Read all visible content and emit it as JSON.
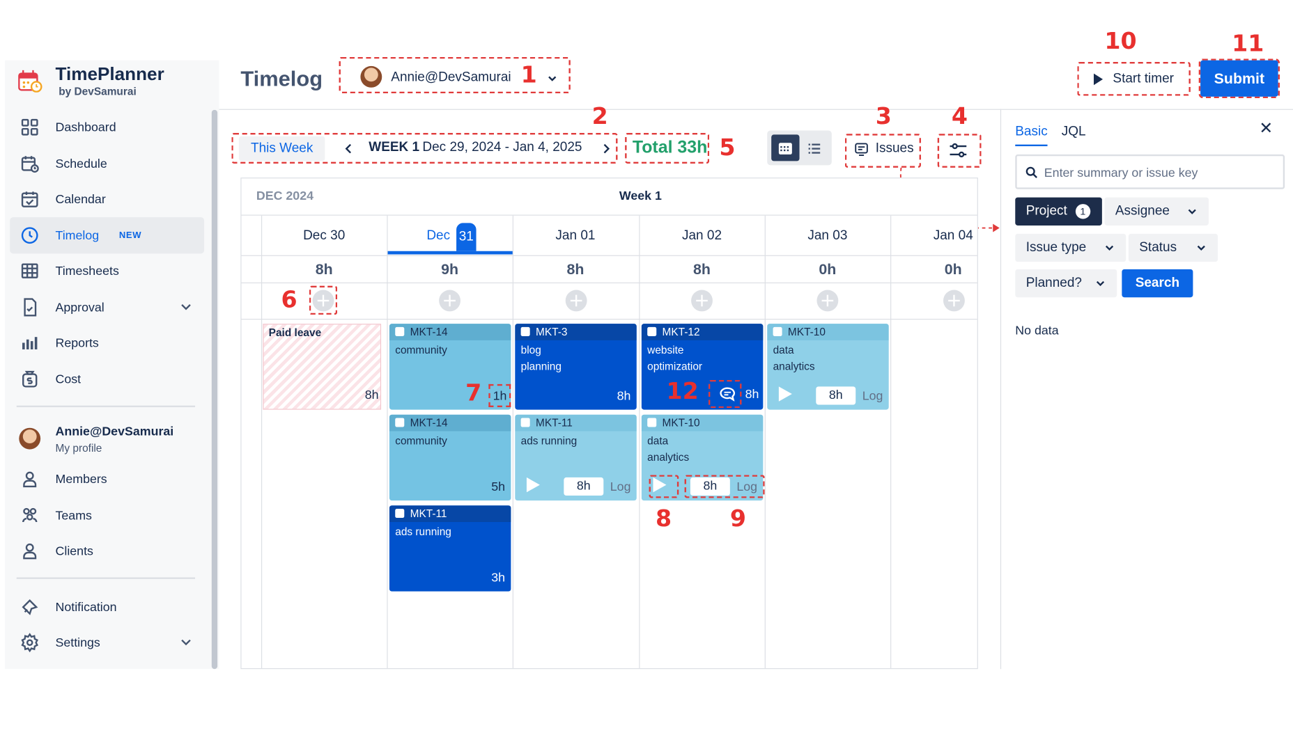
{
  "app": {
    "name": "TimePlanner",
    "by": "by DevSamurai"
  },
  "sidebar": {
    "items": [
      {
        "label": "Dashboard",
        "icon": "dashboard-icon"
      },
      {
        "label": "Schedule",
        "icon": "schedule-icon"
      },
      {
        "label": "Calendar",
        "icon": "calendar-icon"
      },
      {
        "label": "Timelog",
        "icon": "clock-icon",
        "badge": "NEW",
        "active": true
      },
      {
        "label": "Timesheets",
        "icon": "table-icon"
      },
      {
        "label": "Approval",
        "icon": "document-icon",
        "expandable": true
      },
      {
        "label": "Reports",
        "icon": "bar-chart-icon"
      },
      {
        "label": "Cost",
        "icon": "money-icon"
      }
    ],
    "profile": {
      "name": "Annie@DevSamurai",
      "sub": "My profile"
    },
    "people": [
      {
        "label": "Members",
        "icon": "person-icon"
      },
      {
        "label": "Teams",
        "icon": "team-icon"
      },
      {
        "label": "Clients",
        "icon": "client-icon"
      }
    ],
    "bottom": [
      {
        "label": "Notification",
        "icon": "bell-icon"
      },
      {
        "label": "Settings",
        "icon": "gear-icon",
        "expandable": true
      }
    ]
  },
  "header": {
    "title": "Timelog",
    "user": "Annie@DevSamurai",
    "start_timer": "Start timer",
    "submit": "Submit"
  },
  "toolbar": {
    "this_week": "This Week",
    "week_label": "WEEK 1",
    "week_range": "Dec 29, 2024 - Jan 4, 2025",
    "total": "Total 33h",
    "issues": "Issues"
  },
  "grid": {
    "month": "DEC 2024",
    "week": "Week 1",
    "days": [
      {
        "label": "Dec  30",
        "hours": "8h"
      },
      {
        "label": "Dec",
        "num": "31",
        "hours": "9h",
        "today": true
      },
      {
        "label": "Jan  01",
        "hours": "8h"
      },
      {
        "label": "Jan  02",
        "hours": "8h"
      },
      {
        "label": "Jan  03",
        "hours": "0h"
      },
      {
        "label": "Jan  04",
        "hours": "0h"
      }
    ],
    "paid_leave": {
      "label": "Paid leave",
      "hours": "8h"
    },
    "cards": [
      {
        "key": "MKT-14",
        "summary": "community",
        "hours": "1h",
        "style": "light"
      },
      {
        "key": "MKT-14",
        "summary": "community",
        "hours": "5h",
        "style": "light"
      },
      {
        "key": "MKT-11",
        "summary": "ads running",
        "hours": "3h",
        "style": "dark"
      },
      {
        "key": "MKT-3",
        "summary": "blog planning",
        "hours": "8h",
        "style": "dark"
      },
      {
        "key": "MKT-11",
        "summary": "ads running",
        "hours": "8h",
        "log": "Log",
        "style": "planned"
      },
      {
        "key": "MKT-12",
        "summary": "website optimizatior",
        "hours": "8h",
        "style": "dark"
      },
      {
        "key": "MKT-10",
        "summary": "data analytics",
        "hours": "8h",
        "log": "Log",
        "style": "planned"
      },
      {
        "key": "MKT-10",
        "summary": "data analytics",
        "hours": "8h",
        "log": "Log",
        "style": "planned"
      }
    ]
  },
  "panel": {
    "tabs": [
      "Basic",
      "JQL"
    ],
    "search_placeholder": "Enter summary or issue key",
    "filters": {
      "project": "Project",
      "project_count": "1",
      "assignee": "Assignee",
      "issue_type": "Issue type",
      "status": "Status",
      "planned": "Planned?"
    },
    "search_button": "Search",
    "no_data": "No data"
  },
  "callouts": [
    "1",
    "2",
    "3",
    "4",
    "5",
    "6",
    "7",
    "8",
    "9",
    "10",
    "11",
    "12"
  ],
  "colors": {
    "accent": "#0c66e4",
    "callout": "#e8302e",
    "total": "#22a06b",
    "dark_card": "#0052cc",
    "light_card": "#74c3e3"
  }
}
